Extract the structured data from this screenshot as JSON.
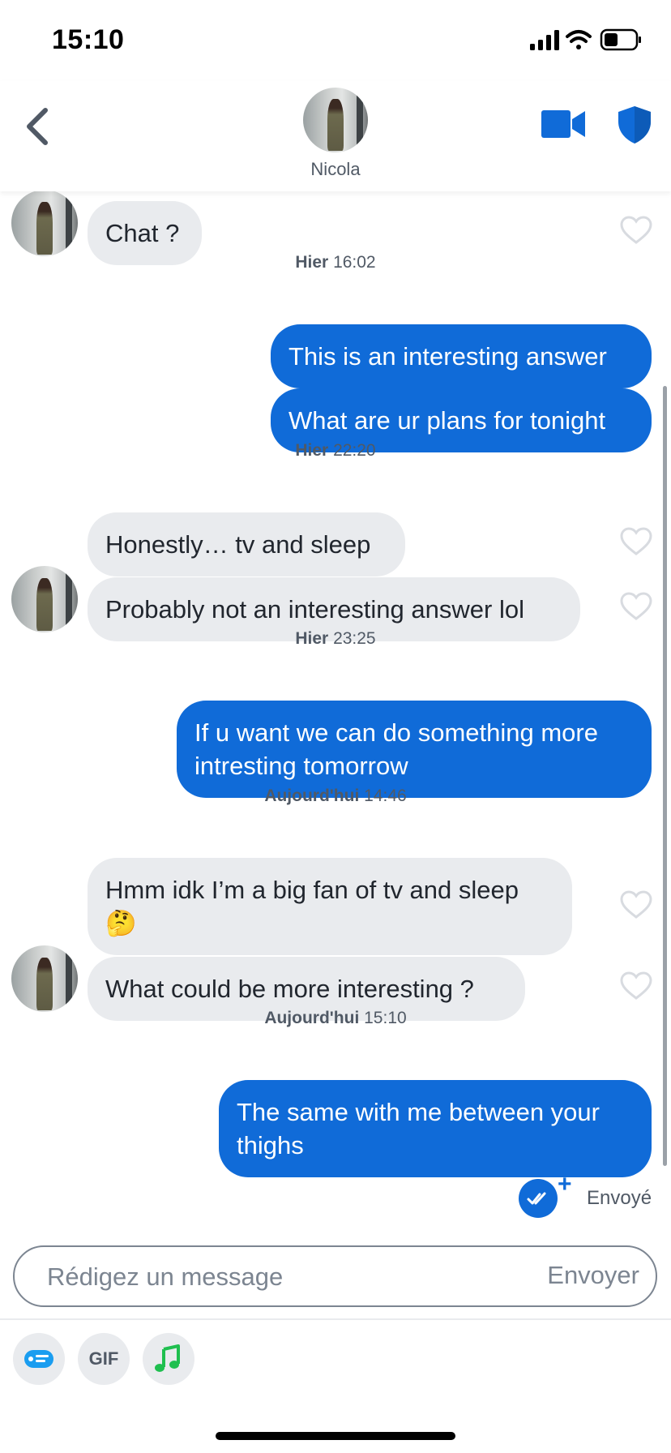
{
  "status_bar": {
    "time": "15:10"
  },
  "header": {
    "contact_name": "Nicola"
  },
  "messages": {
    "m1": "Chat ?",
    "ts1": {
      "day": "Hier",
      "time": "16:02"
    },
    "m2": "This is an interesting answer",
    "m3": "What are ur plans for tonight",
    "ts2": {
      "day": "Hier",
      "time": "22:20"
    },
    "m4": "Honestly… tv and sleep",
    "m5": "Probably not an interesting answer lol",
    "ts3": {
      "day": "Hier",
      "time": "23:25"
    },
    "m6": "If u want we can do something more intresting tomorrow",
    "ts4": {
      "day": "Aujourd'hui",
      "time": "14:46"
    },
    "m7": "Hmm idk I’m a big fan of tv and sleep 🤔",
    "m8": "What could be more interesting ?",
    "ts5": {
      "day": "Aujourd'hui",
      "time": "15:10"
    },
    "m9": "The same with me between your thighs"
  },
  "sent_status": {
    "label": "Envoyé"
  },
  "composer": {
    "placeholder": "Rédigez un message",
    "send_label": "Envoyer"
  },
  "toolbar": {
    "gif_label": "GIF"
  },
  "colors": {
    "accent": "#106bd8",
    "incoming_bubble": "#e9ebee",
    "muted_text": "#505965",
    "music_green": "#1fbf4f"
  },
  "icons": [
    "back-chevron-icon",
    "video-camera-icon",
    "shield-icon",
    "heart-icon",
    "double-check-icon",
    "card-icon",
    "music-note-icon"
  ]
}
